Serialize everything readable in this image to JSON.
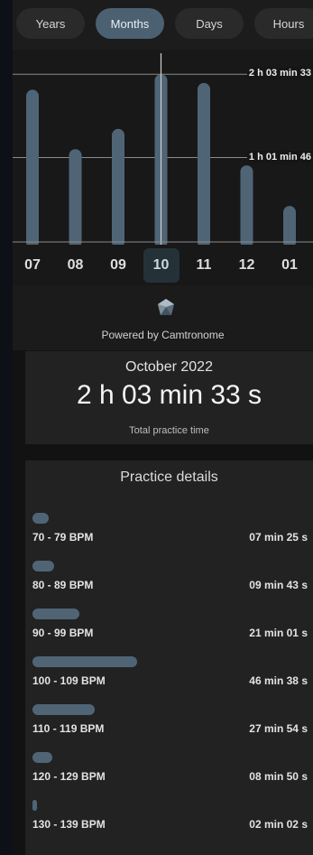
{
  "tabs": [
    {
      "label": "Years",
      "active": false
    },
    {
      "label": "Months",
      "active": true
    },
    {
      "label": "Days",
      "active": false
    },
    {
      "label": "Hours",
      "active": false
    }
  ],
  "chart_data": {
    "type": "bar",
    "categories": [
      "07",
      "08",
      "09",
      "10",
      "11",
      "12",
      "01"
    ],
    "values_minutes": [
      112,
      68,
      83,
      123.5,
      117,
      56,
      26
    ],
    "reference_lines": [
      {
        "label": "2 h 03 min 33",
        "value_minutes": 123.5
      },
      {
        "label": "1 h 01 min 46",
        "value_minutes": 61.8
      }
    ],
    "selected_category": "10",
    "ymax_minutes": 135,
    "bar_color": "#4f6576"
  },
  "month_axis": {
    "labels": [
      "07",
      "08",
      "09",
      "10",
      "11",
      "12",
      "01"
    ],
    "selected": "10"
  },
  "branding": {
    "powered_by": "Powered by Camtronome",
    "icon": "gem-icon"
  },
  "summary": {
    "month": "October 2022",
    "total": "2 h 03 min 33 s",
    "caption": "Total practice time"
  },
  "details": {
    "title": "Practice details",
    "bar_color": "#4f6576",
    "rows": [
      {
        "range": "70 - 79 BPM",
        "duration": "07 min 25 s",
        "seconds": 445
      },
      {
        "range": "80 - 89 BPM",
        "duration": "09 min 43 s",
        "seconds": 583
      },
      {
        "range": "90 - 99 BPM",
        "duration": "21 min 01 s",
        "seconds": 1261
      },
      {
        "range": "100 - 109 BPM",
        "duration": "46 min 38 s",
        "seconds": 2798
      },
      {
        "range": "110 - 119 BPM",
        "duration": "27 min 54 s",
        "seconds": 1674
      },
      {
        "range": "120 - 129 BPM",
        "duration": "08 min 50 s",
        "seconds": 530
      },
      {
        "range": "130 - 139 BPM",
        "duration": "02 min 02 s",
        "seconds": 122
      }
    ]
  }
}
